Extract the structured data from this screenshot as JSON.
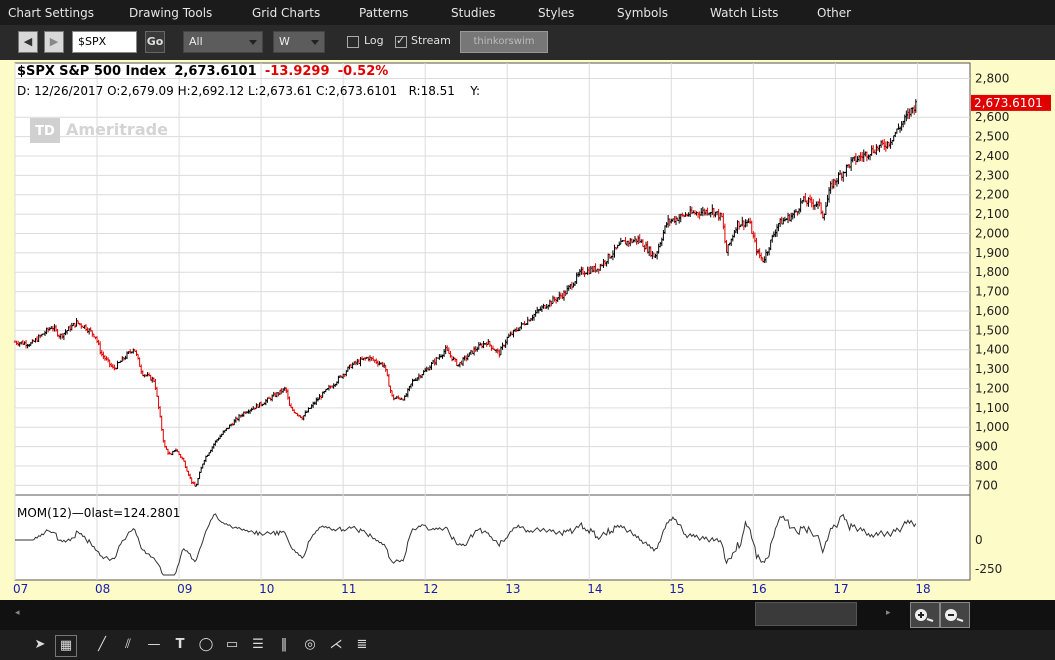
{
  "menu": [
    "Chart Settings",
    "Drawing Tools",
    "Grid Charts",
    "Patterns",
    "Studies",
    "Styles",
    "Symbols",
    "Watch Lists",
    "Other"
  ],
  "toolbar": {
    "back_icon": "left-arrow-icon",
    "forward_icon": "right-arrow-icon",
    "symbol_value": "$SPX",
    "go_label": "Go",
    "period_value": "All",
    "interval_value": "W",
    "log_label": "Log",
    "log_checked": false,
    "stream_label": "Stream",
    "stream_checked": true,
    "platform_label": "thinkorswim"
  },
  "header": {
    "symbol": "$SPX",
    "name": "S&P 500 Index",
    "last": "2,673.6101",
    "change": "-13.9299",
    "change_pct": "-0.52%",
    "date": "D: 12/26/2017",
    "open": "O:2,679.09",
    "high": "H:2,692.12",
    "low": "L:2,673.61",
    "close": "C:2,673.6101",
    "range": "R:18.51",
    "y": "Y:"
  },
  "watermark": "Ameritrade",
  "watermark_badge": "TD",
  "price_tag": "2,673.6101",
  "indicator": {
    "label": "MOM(12)",
    "zero_label": "0",
    "last_label": "last=124.2801",
    "ticks": [
      "0",
      "-250"
    ]
  },
  "colors": {
    "up": "#000000",
    "down": "#e00000",
    "axis": "#444444",
    "accent": "#e00000",
    "year_label": "#1a1ab0"
  },
  "chart_data": {
    "type": "candlestick",
    "symbol": "$SPX",
    "interval": "W",
    "x_years": [
      "07",
      "08",
      "09",
      "10",
      "11",
      "12",
      "13",
      "14",
      "15",
      "16",
      "17",
      "18"
    ],
    "y_ticks": [
      700,
      800,
      900,
      1000,
      1100,
      1200,
      1300,
      1400,
      1500,
      1600,
      1700,
      1800,
      1900,
      2000,
      2100,
      2200,
      2300,
      2400,
      2500,
      2600,
      2800
    ],
    "ylim": [
      650,
      2880
    ],
    "xlim": [
      2007.0,
      2018.3
    ],
    "price_path": [
      [
        2007.0,
        1440
      ],
      [
        2007.2,
        1430
      ],
      [
        2007.45,
        1520
      ],
      [
        2007.55,
        1470
      ],
      [
        2007.75,
        1540
      ],
      [
        2007.85,
        1520
      ],
      [
        2007.98,
        1470
      ],
      [
        2008.05,
        1380
      ],
      [
        2008.2,
        1300
      ],
      [
        2008.45,
        1410
      ],
      [
        2008.55,
        1280
      ],
      [
        2008.7,
        1240
      ],
      [
        2008.75,
        1100
      ],
      [
        2008.82,
        900
      ],
      [
        2008.9,
        850
      ],
      [
        2008.95,
        890
      ],
      [
        2009.05,
        830
      ],
      [
        2009.15,
        720
      ],
      [
        2009.2,
        690
      ],
      [
        2009.3,
        830
      ],
      [
        2009.45,
        930
      ],
      [
        2009.6,
        1000
      ],
      [
        2009.8,
        1080
      ],
      [
        2010.0,
        1120
      ],
      [
        2010.3,
        1200
      ],
      [
        2010.35,
        1100
      ],
      [
        2010.5,
        1050
      ],
      [
        2010.7,
        1150
      ],
      [
        2010.9,
        1230
      ],
      [
        2011.1,
        1320
      ],
      [
        2011.3,
        1360
      ],
      [
        2011.5,
        1320
      ],
      [
        2011.6,
        1150
      ],
      [
        2011.75,
        1150
      ],
      [
        2011.85,
        1240
      ],
      [
        2012.0,
        1290
      ],
      [
        2012.25,
        1400
      ],
      [
        2012.4,
        1320
      ],
      [
        2012.6,
        1400
      ],
      [
        2012.75,
        1440
      ],
      [
        2012.9,
        1380
      ],
      [
        2013.0,
        1460
      ],
      [
        2013.35,
        1590
      ],
      [
        2013.5,
        1640
      ],
      [
        2013.7,
        1690
      ],
      [
        2013.9,
        1800
      ],
      [
        2014.1,
        1820
      ],
      [
        2014.4,
        1950
      ],
      [
        2014.6,
        1970
      ],
      [
        2014.8,
        1880
      ],
      [
        2014.95,
        2060
      ],
      [
        2015.2,
        2100
      ],
      [
        2015.5,
        2120
      ],
      [
        2015.62,
        2080
      ],
      [
        2015.67,
        1900
      ],
      [
        2015.8,
        2050
      ],
      [
        2015.95,
        2060
      ],
      [
        2016.05,
        1900
      ],
      [
        2016.12,
        1860
      ],
      [
        2016.3,
        2050
      ],
      [
        2016.5,
        2100
      ],
      [
        2016.6,
        2170
      ],
      [
        2016.8,
        2150
      ],
      [
        2016.85,
        2090
      ],
      [
        2016.95,
        2250
      ],
      [
        2017.2,
        2370
      ],
      [
        2017.45,
        2430
      ],
      [
        2017.65,
        2470
      ],
      [
        2017.8,
        2560
      ],
      [
        2017.99,
        2674
      ]
    ],
    "mom_ylim": [
      -300,
      300
    ],
    "mom_last": 124.2801
  }
}
